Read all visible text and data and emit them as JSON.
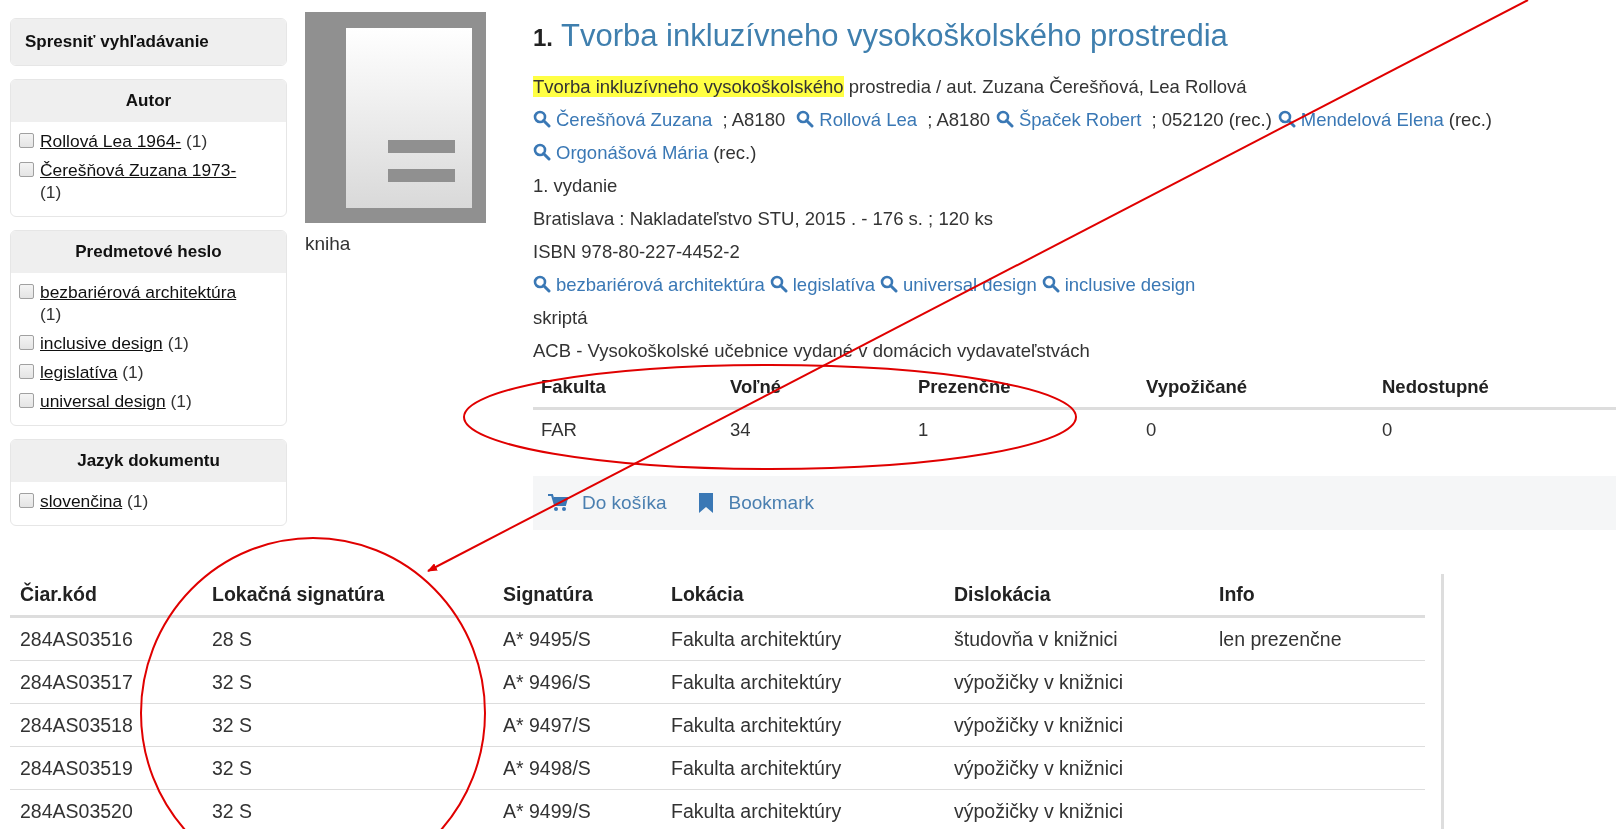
{
  "sidebar": {
    "title": "Spresniť vyhľadávanie",
    "facets": [
      {
        "heading": "Autor",
        "items": [
          {
            "label": "Rollová Lea 1964-",
            "count": "(1)",
            "checked": false
          },
          {
            "label": "Čerešňová Zuzana 1973-",
            "count": "(1)",
            "checked": false
          }
        ]
      },
      {
        "heading": "Predmetové heslo",
        "items": [
          {
            "label": "bezbariérová architektúra",
            "count": "(1)",
            "checked": false
          },
          {
            "label": "inclusive design",
            "count": "(1)",
            "checked": false
          },
          {
            "label": "legislatíva",
            "count": "(1)",
            "checked": false
          },
          {
            "label": "universal design",
            "count": "(1)",
            "checked": false
          }
        ]
      },
      {
        "heading": "Jazyk dokumentu",
        "items": [
          {
            "label": "slovenčina",
            "count": "(1)",
            "checked": false
          }
        ]
      }
    ]
  },
  "record": {
    "type_label": "kniha",
    "number": "1.",
    "title": "Tvorba inkluzívneho vysokoškolského prostredia",
    "statement": {
      "highlighted": "Tvorba inkluzívneho vysokoškolského",
      "rest": " prostredia / aut. Zuzana Čerešňová, Lea Rollová"
    },
    "authors": [
      {
        "name": "Čerešňová Zuzana",
        "note": " ; A8180 "
      },
      {
        "name": "Rollová Lea",
        "note": " ; A8180"
      },
      {
        "name": "Špaček Robert",
        "note": " ; 052120 (rec.)"
      },
      {
        "name": "Mendelová Elena",
        "note": "(rec.)"
      },
      {
        "name": "Orgonášová Mária",
        "note": "(rec.)"
      }
    ],
    "edition": "1. vydanie",
    "publication": "Bratislava : Nakladateľstvo STU, 2015 . - 176 s. ; 120 ks",
    "isbn": "ISBN 978-80-227-4452-2",
    "subjects": [
      "bezbariérová architektúra",
      "legislatíva",
      "universal design",
      "inclusive design"
    ],
    "genre": "skriptá",
    "collection": "ACB - Vysokoškolské učebnice vydané v domácich vydavateľstvách",
    "availability": {
      "columns": [
        "Fakulta",
        "Voľné",
        "Prezenčne",
        "Vypožičané",
        "Nedostupné"
      ],
      "rows": [
        [
          "FAR",
          "34",
          "1",
          "0",
          "0"
        ]
      ]
    },
    "actions": [
      {
        "kind": "cart",
        "label": "Do košíka"
      },
      {
        "kind": "bookmark",
        "label": "Bookmark"
      }
    ]
  },
  "copies": {
    "columns": [
      "Čiar.kód",
      "Lokačná signatúra",
      "Signatúra",
      "Lokácia",
      "Dislokácia",
      "Info"
    ],
    "rows": [
      [
        "284AS03516",
        "28 S",
        "A* 9495/S",
        "Fakulta architektúry",
        "študovňa v knižnici",
        "len prezenčne"
      ],
      [
        "284AS03517",
        "32 S",
        "A* 9496/S",
        "Fakulta architektúry",
        "výpožičky v knižnici",
        ""
      ],
      [
        "284AS03518",
        "32 S",
        "A* 9497/S",
        "Fakulta architektúry",
        "výpožičky v knižnici",
        ""
      ],
      [
        "284AS03519",
        "32 S",
        "A* 9498/S",
        "Fakulta architektúry",
        "výpožičky v knižnici",
        ""
      ],
      [
        "284AS03520",
        "32 S",
        "A* 9499/S",
        "Fakulta architektúry",
        "výpožičky v knižnici",
        ""
      ]
    ]
  }
}
